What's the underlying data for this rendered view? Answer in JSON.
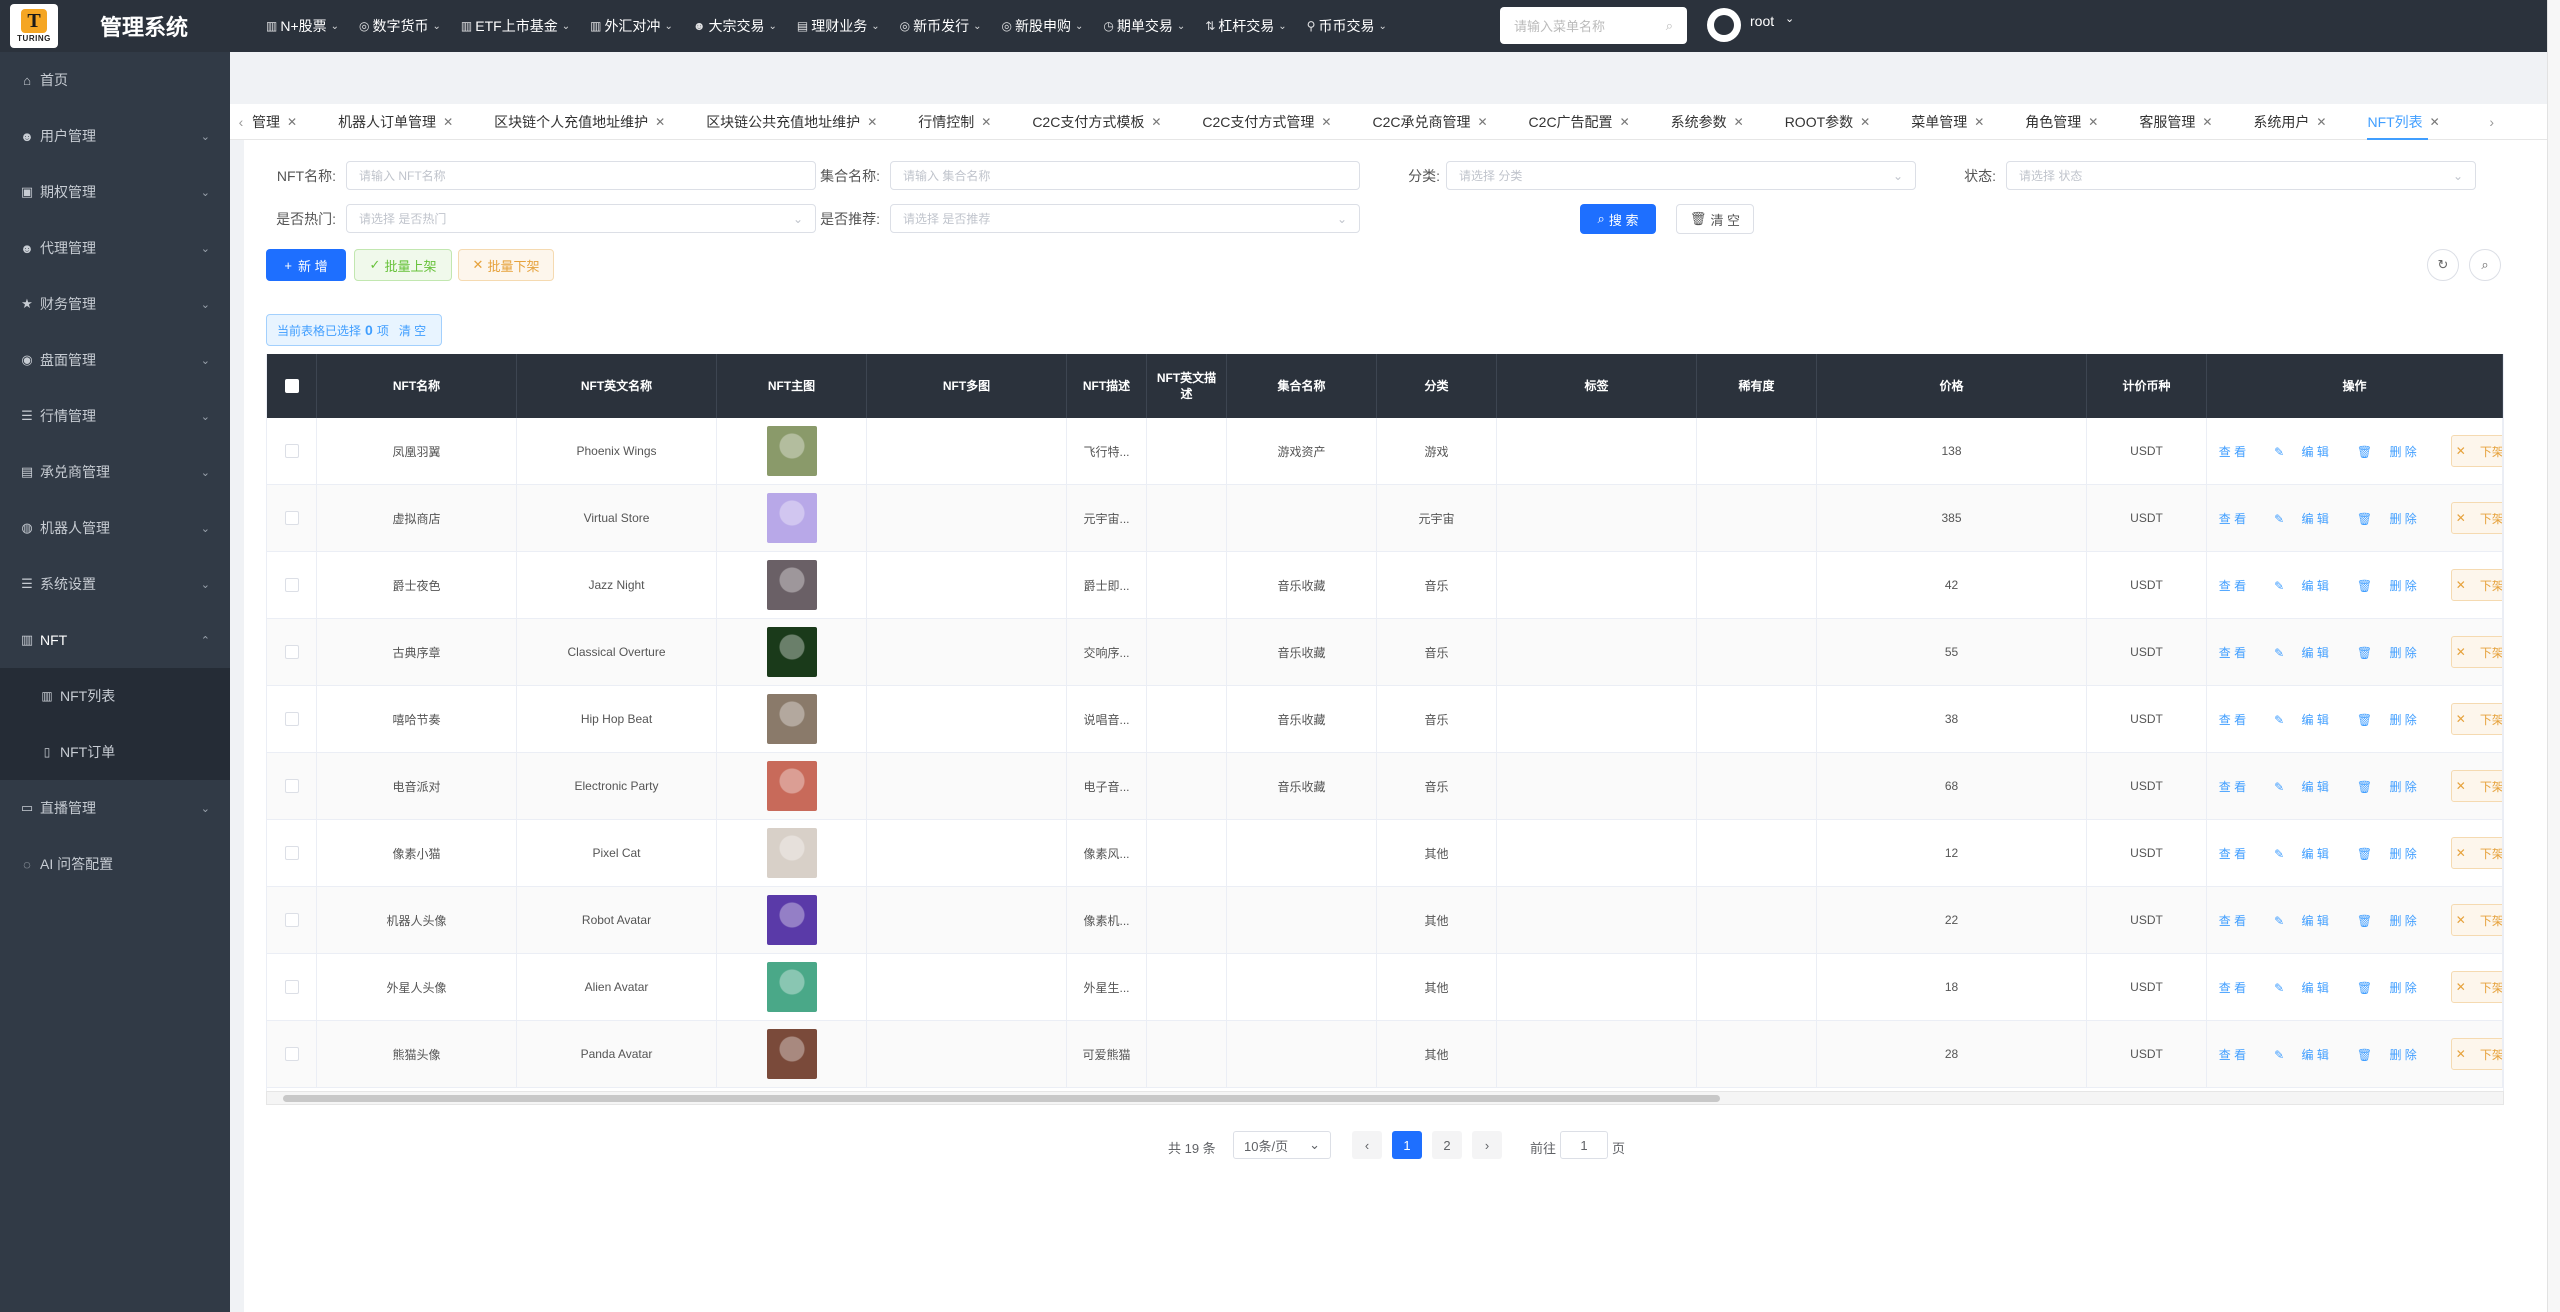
{
  "header": {
    "logo_letter": "T",
    "logo_text": "TURING",
    "app_title": "管理系统",
    "menu": [
      {
        "icon": "chart-icon",
        "label": "N+股票"
      },
      {
        "icon": "coin-icon",
        "label": "数字货币"
      },
      {
        "icon": "chart-icon",
        "label": "ETF上市基金"
      },
      {
        "icon": "chart-icon",
        "label": "外汇对冲"
      },
      {
        "icon": "user-icon",
        "label": "大宗交易"
      },
      {
        "icon": "wallet-icon",
        "label": "理财业务"
      },
      {
        "icon": "coin-icon",
        "label": "新币发行"
      },
      {
        "icon": "coin-icon",
        "label": "新股申购"
      },
      {
        "icon": "clock-icon",
        "label": "期单交易"
      },
      {
        "icon": "lever-icon",
        "label": "杠杆交易"
      },
      {
        "icon": "pin-icon",
        "label": "币币交易"
      }
    ],
    "search_placeholder": "请输入菜单名称",
    "user_name": "root"
  },
  "sidebar": {
    "items": [
      {
        "icon": "home-icon",
        "label": "首页",
        "has_arrow": false
      },
      {
        "icon": "user-icon",
        "label": "用户管理",
        "has_arrow": true
      },
      {
        "icon": "option-icon",
        "label": "期权管理",
        "has_arrow": true
      },
      {
        "icon": "agent-icon",
        "label": "代理管理",
        "has_arrow": true
      },
      {
        "icon": "star-icon",
        "label": "财务管理",
        "has_arrow": true
      },
      {
        "icon": "globe-icon",
        "label": "盘面管理",
        "has_arrow": true
      },
      {
        "icon": "list-icon",
        "label": "行情管理",
        "has_arrow": true
      },
      {
        "icon": "exchange-icon",
        "label": "承兑商管理",
        "has_arrow": true
      },
      {
        "icon": "robot-icon",
        "label": "机器人管理",
        "has_arrow": true
      },
      {
        "icon": "settings-icon",
        "label": "系统设置",
        "has_arrow": true
      },
      {
        "icon": "chart-icon",
        "label": "NFT",
        "has_arrow": true
      }
    ],
    "sub_items": [
      {
        "icon": "chart-icon",
        "label": "NFT列表"
      },
      {
        "icon": "doc-icon",
        "label": "NFT订单"
      }
    ],
    "items_after": [
      {
        "icon": "video-icon",
        "label": "直播管理",
        "has_arrow": true
      },
      {
        "icon": "ai-icon",
        "label": "AI 问答配置",
        "has_arrow": false
      }
    ]
  },
  "tabs": [
    "管理",
    "机器人订单管理",
    "区块链个人充值地址维护",
    "区块链公共充值地址维护",
    "行情控制",
    "C2C支付方式模板",
    "C2C支付方式管理",
    "C2C承兑商管理",
    "C2C广告配置",
    "系统参数",
    "ROOT参数",
    "菜单管理",
    "角色管理",
    "客服管理",
    "系统用户",
    "NFT列表"
  ],
  "filters": {
    "nft_name_label": "NFT名称:",
    "nft_name_placeholder": "请输入 NFT名称",
    "collection_label": "集合名称:",
    "collection_placeholder": "请输入 集合名称",
    "category_label": "分类:",
    "category_placeholder": "请选择 分类",
    "status_label": "状态:",
    "status_placeholder": "请选择 状态",
    "hot_label": "是否热门:",
    "hot_placeholder": "请选择 是否热门",
    "recommend_label": "是否推荐:",
    "recommend_placeholder": "请选择 是否推荐",
    "search_button": "搜 索",
    "clear_button": "清 空"
  },
  "toolbar": {
    "add_button": "新 增",
    "batch_on_button": "批量上架",
    "batch_off_button": "批量下架"
  },
  "selection": {
    "prefix": "当前表格已选择",
    "count": "0",
    "suffix": "项",
    "clear": "清 空"
  },
  "table": {
    "headers": [
      "NFT名称",
      "NFT英文名称",
      "NFT主图",
      "NFT多图",
      "NFT描述",
      "NFT英文描述",
      "集合名称",
      "分类",
      "标签",
      "稀有度",
      "价格",
      "计价币种",
      "操作"
    ],
    "actions": {
      "view": "查 看",
      "edit": "编 辑",
      "delete": "删 除",
      "off": "下架"
    },
    "rows": [
      {
        "name": "凤凰羽翼",
        "en_name": "Phoenix Wings",
        "desc": "飞行特...",
        "collection": "游戏资产",
        "category": "游戏",
        "price": "138",
        "currency": "USDT",
        "img_color": "#8a9a6a"
      },
      {
        "name": "虚拟商店",
        "en_name": "Virtual Store",
        "desc": "元宇宙...",
        "collection": "",
        "category": "元宇宙",
        "price": "385",
        "currency": "USDT",
        "img_color": "#b8a8e8"
      },
      {
        "name": "爵士夜色",
        "en_name": "Jazz Night",
        "desc": "爵士即...",
        "collection": "音乐收藏",
        "category": "音乐",
        "price": "42",
        "currency": "USDT",
        "img_color": "#6a6066"
      },
      {
        "name": "古典序章",
        "en_name": "Classical Overture",
        "desc": "交响序...",
        "collection": "音乐收藏",
        "category": "音乐",
        "price": "55",
        "currency": "USDT",
        "img_color": "#1a3a1a"
      },
      {
        "name": "嘻哈节奏",
        "en_name": "Hip Hop Beat",
        "desc": "说唱音...",
        "collection": "音乐收藏",
        "category": "音乐",
        "price": "38",
        "currency": "USDT",
        "img_color": "#8a7a6a"
      },
      {
        "name": "电音派对",
        "en_name": "Electronic Party",
        "desc": "电子音...",
        "collection": "音乐收藏",
        "category": "音乐",
        "price": "68",
        "currency": "USDT",
        "img_color": "#c86a5a"
      },
      {
        "name": "像素小猫",
        "en_name": "Pixel Cat",
        "desc": "像素风...",
        "collection": "",
        "category": "其他",
        "price": "12",
        "currency": "USDT",
        "img_color": "#d8d0c8"
      },
      {
        "name": "机器人头像",
        "en_name": "Robot Avatar",
        "desc": "像素机...",
        "collection": "",
        "category": "其他",
        "price": "22",
        "currency": "USDT",
        "img_color": "#5a3aa8"
      },
      {
        "name": "外星人头像",
        "en_name": "Alien Avatar",
        "desc": "外星生...",
        "collection": "",
        "category": "其他",
        "price": "18",
        "currency": "USDT",
        "img_color": "#4aa888"
      },
      {
        "name": "熊猫头像",
        "en_name": "Panda Avatar",
        "desc": "可爱熊猫",
        "collection": "",
        "category": "其他",
        "price": "28",
        "currency": "USDT",
        "img_color": "#7a4a3a"
      }
    ]
  },
  "pagination": {
    "total": "共 19 条",
    "page_size": "10条/页",
    "pages": [
      "1",
      "2"
    ],
    "current": "1",
    "goto_label": "前往",
    "goto_value": "1",
    "page_suffix": "页"
  }
}
